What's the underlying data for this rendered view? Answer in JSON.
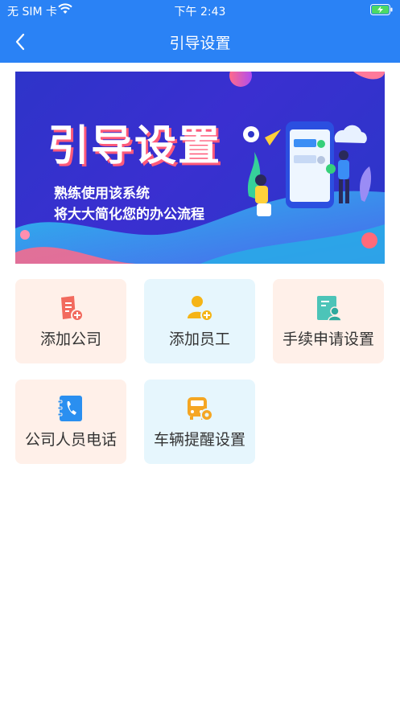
{
  "status_bar": {
    "carrier": "无 SIM 卡",
    "time": "下午 2:43"
  },
  "nav": {
    "title": "引导设置",
    "back_icon": "chevron-left-icon"
  },
  "banner": {
    "heading": "引导设置",
    "line1": "熟练使用该系统",
    "line2": "将大大简化您的办公流程"
  },
  "tiles": [
    {
      "label": "添加公司",
      "icon": "company-add-icon",
      "color": "#f26a5e"
    },
    {
      "label": "添加员工",
      "icon": "employee-add-icon",
      "color": "#f5b416"
    },
    {
      "label": "手续申请设置",
      "icon": "document-user-icon",
      "color": "#4cc4b8"
    },
    {
      "label": "公司人员电话",
      "icon": "phonebook-icon",
      "color": "#2a8ff0"
    },
    {
      "label": "车辆提醒设置",
      "icon": "vehicle-settings-icon",
      "color": "#f5a623"
    }
  ],
  "colors": {
    "primary": "#2a82f5",
    "tile_peach": "#fff0e9",
    "tile_blue": "#e6f6fd"
  }
}
